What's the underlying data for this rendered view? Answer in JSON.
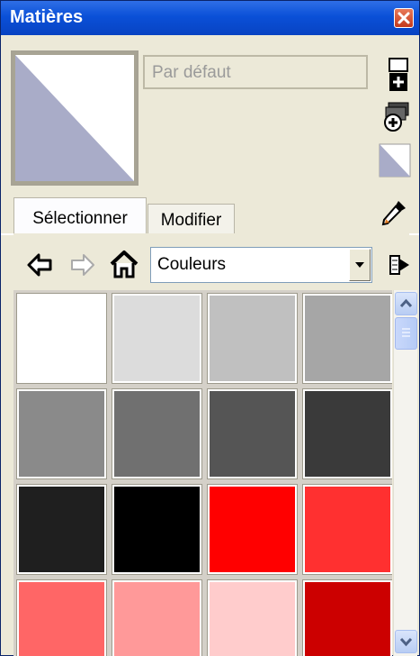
{
  "window": {
    "title": "Matières"
  },
  "material": {
    "name_placeholder": "Par défaut"
  },
  "tabs": [
    {
      "label": "Sélectionner"
    },
    {
      "label": "Modifier"
    }
  ],
  "library": {
    "selected": "Couleurs"
  },
  "icons": {
    "close": "close-icon",
    "create": "create-material-icon",
    "detail": "details-icon",
    "default_material": "default-material-icon",
    "sample": "eyedropper-icon",
    "back": "back-arrow-icon",
    "forward": "forward-arrow-icon",
    "home": "home-icon",
    "chevron": "chevron-down-icon",
    "details_arrow": "details-arrow-icon"
  },
  "swatches": [
    "#ffffff",
    "#dcdcdc",
    "#c0c0c0",
    "#a6a6a6",
    "#8a8a8a",
    "#707070",
    "#555555",
    "#3a3a3a",
    "#1f1f1f",
    "#000000",
    "#ff0000",
    "#ff3030",
    "#ff6666",
    "#ff9999",
    "#ffcccc",
    "#cc0000"
  ],
  "colors": {
    "titlebar": "#0a50d8",
    "default_material_fill": "#a9acc8"
  }
}
